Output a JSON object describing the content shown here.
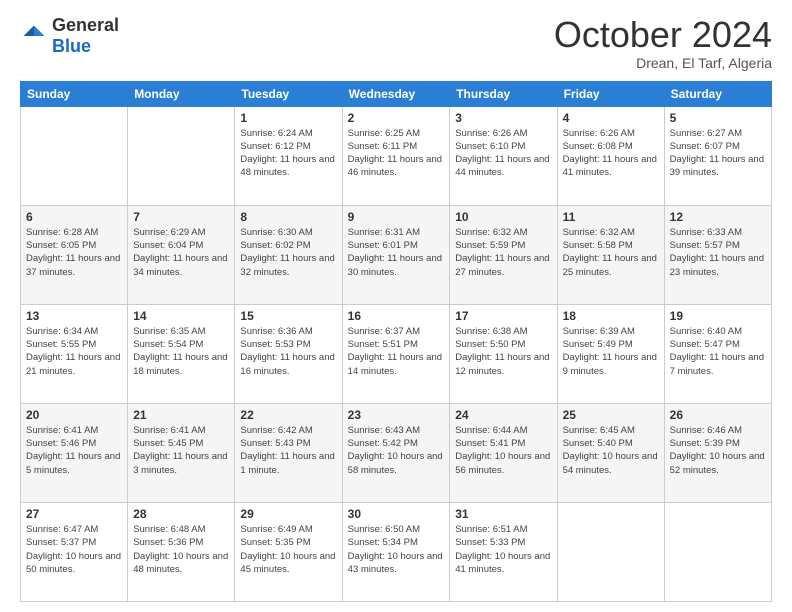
{
  "header": {
    "logo": {
      "general": "General",
      "blue": "Blue"
    },
    "title": "October 2024",
    "location": "Drean, El Tarf, Algeria"
  },
  "calendar": {
    "days_of_week": [
      "Sunday",
      "Monday",
      "Tuesday",
      "Wednesday",
      "Thursday",
      "Friday",
      "Saturday"
    ],
    "weeks": [
      [
        {
          "day": "",
          "sunrise": "",
          "sunset": "",
          "daylight": ""
        },
        {
          "day": "",
          "sunrise": "",
          "sunset": "",
          "daylight": ""
        },
        {
          "day": "1",
          "sunrise": "Sunrise: 6:24 AM",
          "sunset": "Sunset: 6:12 PM",
          "daylight": "Daylight: 11 hours and 48 minutes."
        },
        {
          "day": "2",
          "sunrise": "Sunrise: 6:25 AM",
          "sunset": "Sunset: 6:11 PM",
          "daylight": "Daylight: 11 hours and 46 minutes."
        },
        {
          "day": "3",
          "sunrise": "Sunrise: 6:26 AM",
          "sunset": "Sunset: 6:10 PM",
          "daylight": "Daylight: 11 hours and 44 minutes."
        },
        {
          "day": "4",
          "sunrise": "Sunrise: 6:26 AM",
          "sunset": "Sunset: 6:08 PM",
          "daylight": "Daylight: 11 hours and 41 minutes."
        },
        {
          "day": "5",
          "sunrise": "Sunrise: 6:27 AM",
          "sunset": "Sunset: 6:07 PM",
          "daylight": "Daylight: 11 hours and 39 minutes."
        }
      ],
      [
        {
          "day": "6",
          "sunrise": "Sunrise: 6:28 AM",
          "sunset": "Sunset: 6:05 PM",
          "daylight": "Daylight: 11 hours and 37 minutes."
        },
        {
          "day": "7",
          "sunrise": "Sunrise: 6:29 AM",
          "sunset": "Sunset: 6:04 PM",
          "daylight": "Daylight: 11 hours and 34 minutes."
        },
        {
          "day": "8",
          "sunrise": "Sunrise: 6:30 AM",
          "sunset": "Sunset: 6:02 PM",
          "daylight": "Daylight: 11 hours and 32 minutes."
        },
        {
          "day": "9",
          "sunrise": "Sunrise: 6:31 AM",
          "sunset": "Sunset: 6:01 PM",
          "daylight": "Daylight: 11 hours and 30 minutes."
        },
        {
          "day": "10",
          "sunrise": "Sunrise: 6:32 AM",
          "sunset": "Sunset: 5:59 PM",
          "daylight": "Daylight: 11 hours and 27 minutes."
        },
        {
          "day": "11",
          "sunrise": "Sunrise: 6:32 AM",
          "sunset": "Sunset: 5:58 PM",
          "daylight": "Daylight: 11 hours and 25 minutes."
        },
        {
          "day": "12",
          "sunrise": "Sunrise: 6:33 AM",
          "sunset": "Sunset: 5:57 PM",
          "daylight": "Daylight: 11 hours and 23 minutes."
        }
      ],
      [
        {
          "day": "13",
          "sunrise": "Sunrise: 6:34 AM",
          "sunset": "Sunset: 5:55 PM",
          "daylight": "Daylight: 11 hours and 21 minutes."
        },
        {
          "day": "14",
          "sunrise": "Sunrise: 6:35 AM",
          "sunset": "Sunset: 5:54 PM",
          "daylight": "Daylight: 11 hours and 18 minutes."
        },
        {
          "day": "15",
          "sunrise": "Sunrise: 6:36 AM",
          "sunset": "Sunset: 5:53 PM",
          "daylight": "Daylight: 11 hours and 16 minutes."
        },
        {
          "day": "16",
          "sunrise": "Sunrise: 6:37 AM",
          "sunset": "Sunset: 5:51 PM",
          "daylight": "Daylight: 11 hours and 14 minutes."
        },
        {
          "day": "17",
          "sunrise": "Sunrise: 6:38 AM",
          "sunset": "Sunset: 5:50 PM",
          "daylight": "Daylight: 11 hours and 12 minutes."
        },
        {
          "day": "18",
          "sunrise": "Sunrise: 6:39 AM",
          "sunset": "Sunset: 5:49 PM",
          "daylight": "Daylight: 11 hours and 9 minutes."
        },
        {
          "day": "19",
          "sunrise": "Sunrise: 6:40 AM",
          "sunset": "Sunset: 5:47 PM",
          "daylight": "Daylight: 11 hours and 7 minutes."
        }
      ],
      [
        {
          "day": "20",
          "sunrise": "Sunrise: 6:41 AM",
          "sunset": "Sunset: 5:46 PM",
          "daylight": "Daylight: 11 hours and 5 minutes."
        },
        {
          "day": "21",
          "sunrise": "Sunrise: 6:41 AM",
          "sunset": "Sunset: 5:45 PM",
          "daylight": "Daylight: 11 hours and 3 minutes."
        },
        {
          "day": "22",
          "sunrise": "Sunrise: 6:42 AM",
          "sunset": "Sunset: 5:43 PM",
          "daylight": "Daylight: 11 hours and 1 minute."
        },
        {
          "day": "23",
          "sunrise": "Sunrise: 6:43 AM",
          "sunset": "Sunset: 5:42 PM",
          "daylight": "Daylight: 10 hours and 58 minutes."
        },
        {
          "day": "24",
          "sunrise": "Sunrise: 6:44 AM",
          "sunset": "Sunset: 5:41 PM",
          "daylight": "Daylight: 10 hours and 56 minutes."
        },
        {
          "day": "25",
          "sunrise": "Sunrise: 6:45 AM",
          "sunset": "Sunset: 5:40 PM",
          "daylight": "Daylight: 10 hours and 54 minutes."
        },
        {
          "day": "26",
          "sunrise": "Sunrise: 6:46 AM",
          "sunset": "Sunset: 5:39 PM",
          "daylight": "Daylight: 10 hours and 52 minutes."
        }
      ],
      [
        {
          "day": "27",
          "sunrise": "Sunrise: 6:47 AM",
          "sunset": "Sunset: 5:37 PM",
          "daylight": "Daylight: 10 hours and 50 minutes."
        },
        {
          "day": "28",
          "sunrise": "Sunrise: 6:48 AM",
          "sunset": "Sunset: 5:36 PM",
          "daylight": "Daylight: 10 hours and 48 minutes."
        },
        {
          "day": "29",
          "sunrise": "Sunrise: 6:49 AM",
          "sunset": "Sunset: 5:35 PM",
          "daylight": "Daylight: 10 hours and 45 minutes."
        },
        {
          "day": "30",
          "sunrise": "Sunrise: 6:50 AM",
          "sunset": "Sunset: 5:34 PM",
          "daylight": "Daylight: 10 hours and 43 minutes."
        },
        {
          "day": "31",
          "sunrise": "Sunrise: 6:51 AM",
          "sunset": "Sunset: 5:33 PM",
          "daylight": "Daylight: 10 hours and 41 minutes."
        },
        {
          "day": "",
          "sunrise": "",
          "sunset": "",
          "daylight": ""
        },
        {
          "day": "",
          "sunrise": "",
          "sunset": "",
          "daylight": ""
        }
      ]
    ]
  }
}
